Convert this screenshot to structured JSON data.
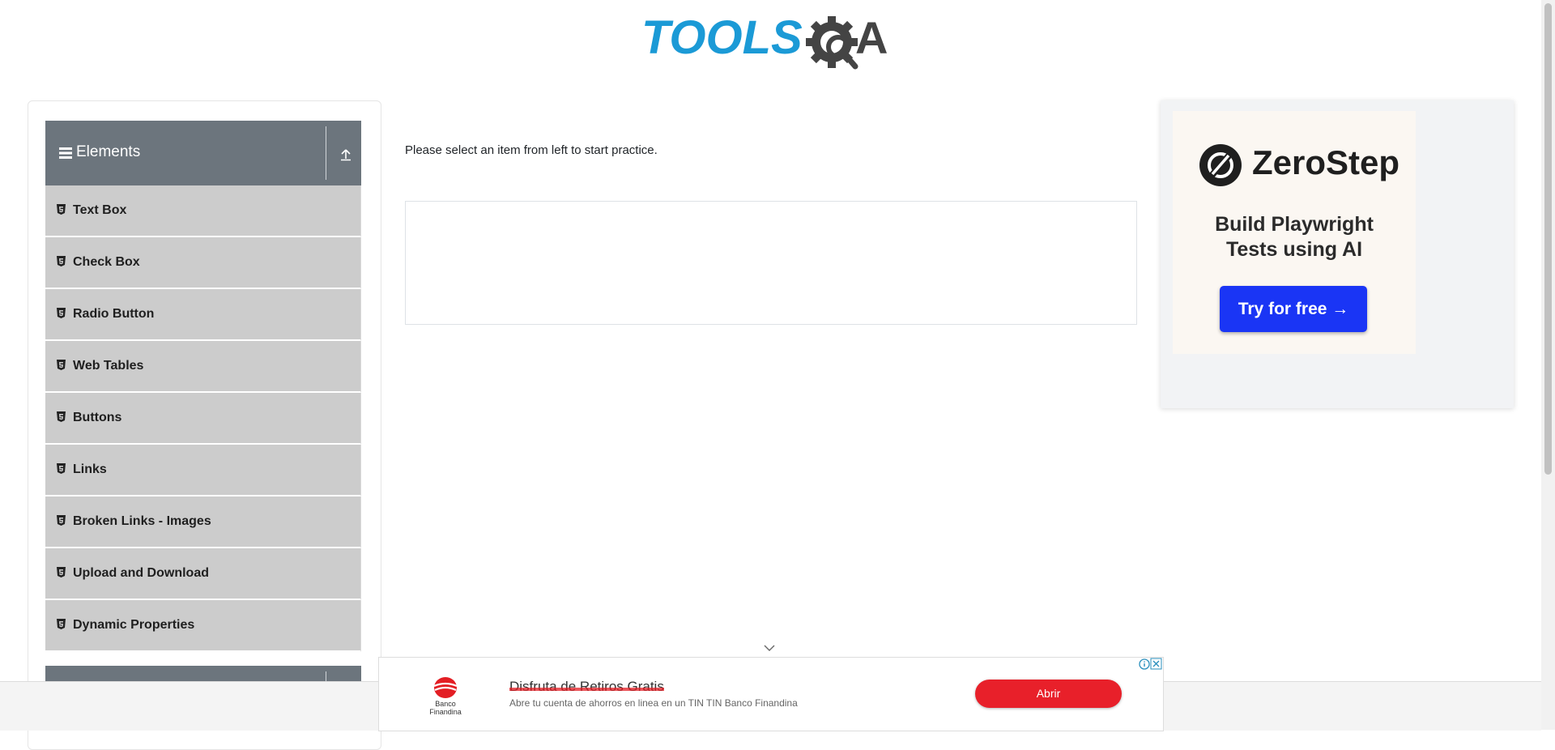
{
  "logo": {
    "text_left": "TOOLS",
    "text_right": "QA",
    "colors": {
      "tools": "#1b9ad6",
      "qa": "#444444"
    }
  },
  "sidebar": {
    "group_title": "Elements",
    "items": [
      {
        "label": "Text Box"
      },
      {
        "label": "Check Box"
      },
      {
        "label": "Radio Button"
      },
      {
        "label": "Web Tables"
      },
      {
        "label": "Buttons"
      },
      {
        "label": "Links"
      },
      {
        "label": "Broken Links - Images"
      },
      {
        "label": "Upload and Download"
      },
      {
        "label": "Dynamic Properties"
      }
    ]
  },
  "main": {
    "instruction": "Please select an item from left to start practice."
  },
  "ad_right": {
    "brand": "ZeroStep",
    "tagline_line1": "Build Playwright",
    "tagline_line2": "Tests using AI",
    "cta": "Try for free →",
    "colors": {
      "cta": "#1a35f5"
    }
  },
  "bottom_ad": {
    "brand_line1": "Banco",
    "brand_line2": "Finandina",
    "title": "Disfruta de Retiros Gratis",
    "subtitle": "Abre tu cuenta de ahorros en linea en un TIN TIN Banco Finandina",
    "cta": "Abrir",
    "colors": {
      "cta": "#e8202a"
    }
  },
  "icons": [
    "hamburger-icon",
    "collapse-up-icon",
    "html5-icon",
    "gear-icon",
    "magnifier-icon",
    "zerostep-logo-icon",
    "chevron-down-icon",
    "info-icon",
    "close-icon"
  ]
}
